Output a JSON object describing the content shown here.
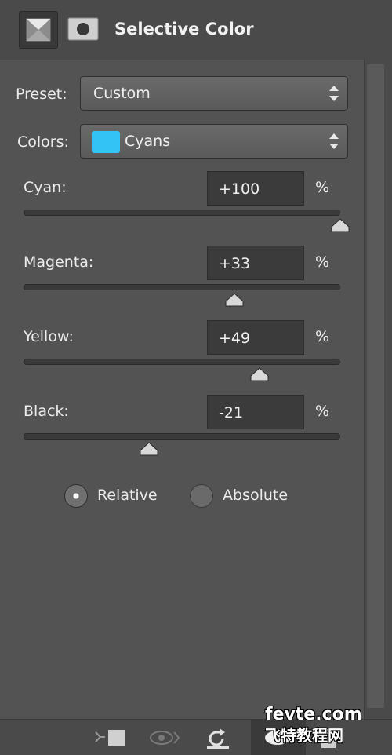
{
  "header": {
    "title": "Selective Color",
    "adjustment_icon": "selective-color-adjustment-icon",
    "mask_icon": "layer-mask-icon"
  },
  "preset": {
    "label": "Preset:",
    "value": "Custom"
  },
  "colors": {
    "label": "Colors:",
    "value": "Cyans",
    "swatch_color": "#33c4f5"
  },
  "sliders": [
    {
      "label": "Cyan:",
      "value": "+100",
      "unit": "%",
      "level": 100
    },
    {
      "label": "Magenta:",
      "value": "+33",
      "unit": "%",
      "level": 33
    },
    {
      "label": "Yellow:",
      "value": "+49",
      "unit": "%",
      "level": 49
    },
    {
      "label": "Black:",
      "value": "-21",
      "unit": "%",
      "level": -21
    }
  ],
  "method": {
    "options": [
      {
        "label": "Relative",
        "selected": true
      },
      {
        "label": "Absolute",
        "selected": false
      }
    ]
  },
  "bottom_toolbar": {
    "icons": [
      "clip-to-layer-icon",
      "view-previous-state-icon",
      "reset-icon",
      "visibility-eye-icon",
      "delete-icon"
    ]
  },
  "watermark": {
    "line1": "fevte.com",
    "line2": "飞特教程网"
  }
}
